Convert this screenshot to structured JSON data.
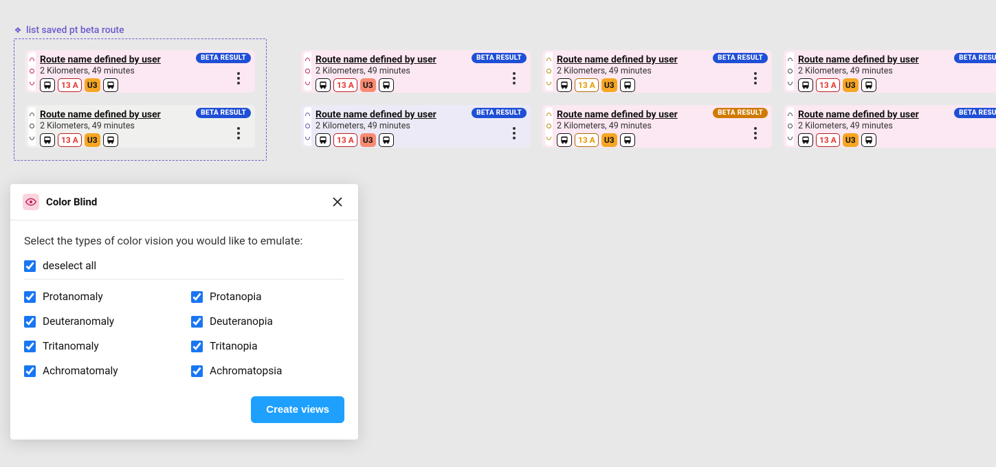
{
  "selection_label": "list saved pt beta route",
  "colors": {
    "badge_blue": "#1f4fd6",
    "badge_orange": "#d07a00",
    "pink_bg": "#fce8f2",
    "lavender_bg": "#eceaf6",
    "grey_bg": "#f0f0ee",
    "magenta": "#c2185b",
    "purple": "#5b4a9e",
    "mustard": "#b58900",
    "dark": "#444",
    "chip13_red": "#e53935",
    "chip13_red_border": "#b71c1c",
    "chip13_orange": "#e69a00",
    "chip13_orange_border": "#a86c00",
    "chipU3_orange": "#f5a623",
    "chipU3_salmon": "#f98b72",
    "primary": "#1ea0ff",
    "checkbox": "#1976f2"
  },
  "card_defaults": {
    "title": "Route name defined by user",
    "subtitle": "2 Kilometers, 49 minutes",
    "badge": "BETA RESULT",
    "line_label": "13 A",
    "u_label": "U3"
  },
  "cards": [
    {
      "row": 0,
      "col": 0,
      "bg": "pink_bg",
      "stripe": "magenta",
      "line13_color": "chip13_red",
      "line13_border": "chip13_red_border",
      "u3_color": "chipU3_orange",
      "badge_color": "badge_blue",
      "has_more": true
    },
    {
      "row": 0,
      "col": 1,
      "bg": "pink_bg",
      "stripe": "magenta",
      "line13_color": "chip13_red",
      "line13_border": "chip13_red_border",
      "u3_color": "chipU3_salmon",
      "badge_color": "badge_blue",
      "has_more": true
    },
    {
      "row": 0,
      "col": 2,
      "bg": "pink_bg",
      "stripe": "mustard",
      "line13_color": "chip13_orange",
      "line13_border": "chip13_orange_border",
      "u3_color": "chipU3_orange",
      "badge_color": "badge_blue",
      "has_more": true
    },
    {
      "row": 0,
      "col": 3,
      "bg": "pink_bg",
      "stripe": "dark",
      "line13_color": "chip13_red",
      "line13_border": "chip13_red_border",
      "u3_color": "chipU3_orange",
      "badge_color": "badge_blue",
      "has_more": false
    },
    {
      "row": 1,
      "col": 0,
      "bg": "grey_bg",
      "stripe": "dark",
      "line13_color": "chip13_red",
      "line13_border": "chip13_red_border",
      "u3_color": "chipU3_orange",
      "badge_color": "badge_blue",
      "has_more": true
    },
    {
      "row": 1,
      "col": 1,
      "bg": "lavender_bg",
      "stripe": "purple",
      "line13_color": "chip13_red",
      "line13_border": "chip13_red_border",
      "u3_color": "chipU3_salmon",
      "badge_color": "badge_blue",
      "has_more": true
    },
    {
      "row": 1,
      "col": 2,
      "bg": "pink_bg",
      "stripe": "mustard",
      "line13_color": "chip13_orange",
      "line13_border": "chip13_orange_border",
      "u3_color": "chipU3_orange",
      "badge_color": "badge_orange",
      "has_more": true
    },
    {
      "row": 1,
      "col": 3,
      "bg": "pink_bg",
      "stripe": "dark",
      "line13_color": "chip13_red",
      "line13_border": "chip13_red_border",
      "u3_color": "chipU3_orange",
      "badge_color": "badge_blue",
      "has_more": false
    }
  ],
  "modal": {
    "title": "Color Blind",
    "prompt": "Select the types of color vision you would like to emulate:",
    "deselect_label": "deselect all",
    "options_left": [
      "Protanomaly",
      "Deuteranomaly",
      "Tritanomaly",
      "Achromatomaly"
    ],
    "options_right": [
      "Protanopia",
      "Deuteranopia",
      "Tritanopia",
      "Achromatopsia"
    ],
    "submit_label": "Create views"
  }
}
